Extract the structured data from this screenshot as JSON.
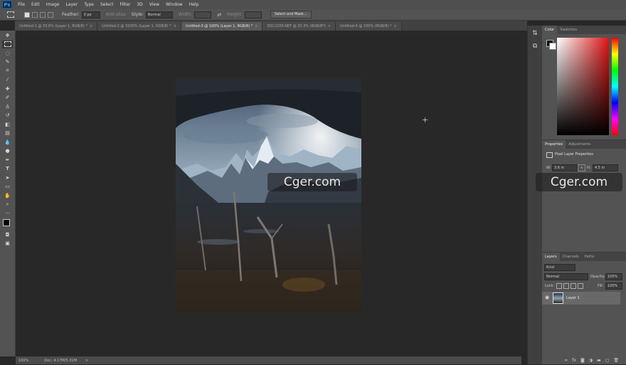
{
  "app": {
    "logo": "Ps"
  },
  "menu": [
    "File",
    "Edit",
    "Image",
    "Layer",
    "Type",
    "Select",
    "Filter",
    "3D",
    "View",
    "Window",
    "Help"
  ],
  "options": {
    "feather_label": "Feather:",
    "feather_value": "0 px",
    "antialias_label": "Anti-alias",
    "style_label": "Style:",
    "style_value": "Normal",
    "width_label": "Width:",
    "height_label": "Height:",
    "mask_button": "Select and Mask..."
  },
  "tabs": [
    {
      "label": "Untitled-1 @ 33.6% (Layer 1, RGB/8) *",
      "close": "×"
    },
    {
      "label": "Untitled-2 @ 3200% (Layer 1, RGB/8) *",
      "close": "×"
    },
    {
      "label": "Untitled-3 @ 100% (Layer 1, RGB/8) *",
      "close": "×"
    },
    {
      "label": "DSC2200.NEF @ 33.3% (RGB/8*)",
      "close": "×"
    },
    {
      "label": "Untitled-4 @ 100% (RGB/8) *",
      "close": "×"
    }
  ],
  "status": {
    "zoom": "100%",
    "doc": "Doc: 4.17M/5.31M",
    "arrow": ">"
  },
  "watermark": "Cger.com",
  "panels": {
    "color_tabs": [
      "Color",
      "Swatches"
    ],
    "properties_tabs": [
      "Properties",
      "Adjustments"
    ],
    "properties_title": "Pixel Layer Properties",
    "w_label": "W:",
    "w_value": "3.6 in",
    "h_label": "H:",
    "h_value": "4.5 in",
    "layers_tabs": [
      "Layers",
      "Channels",
      "Paths"
    ],
    "kind_value": "Kind",
    "blend_mode": "Normal",
    "opacity_label": "Opacity:",
    "opacity_value": "100%",
    "lock_label": "Lock:",
    "fill_label": "Fill:",
    "fill_value": "100%",
    "layer_name": "Layer 1"
  },
  "colors": {
    "accent_blue": "#39a6ff",
    "canvas_bg": "#282828",
    "panel_bg": "#535353"
  }
}
